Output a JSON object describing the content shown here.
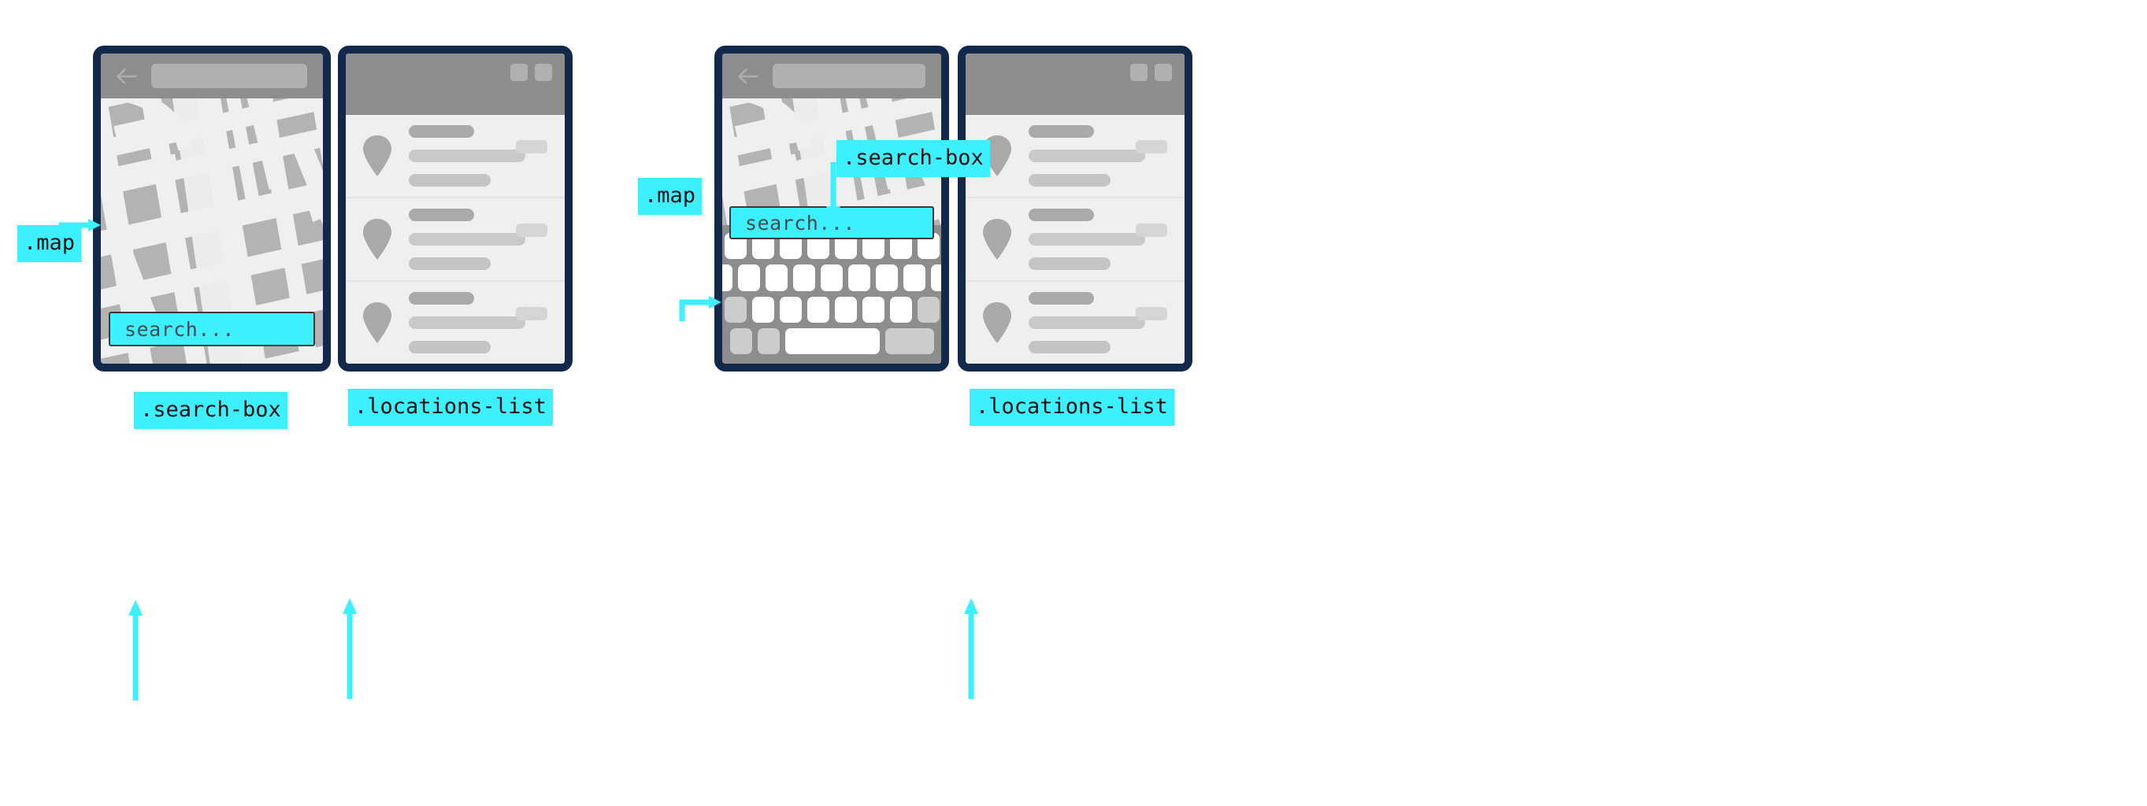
{
  "meta": {
    "accent_color": "#3df0ff",
    "frame_color": "#13294b",
    "map_base_color": "#b3b3b3",
    "road_color": "#efefef",
    "chrome_color": "#8d8d8d"
  },
  "annotations": [
    {
      "id": "map-left",
      "text": ".map"
    },
    {
      "id": "search-box-left",
      "text": ".search-box"
    },
    {
      "id": "locations-list-left",
      "text": ".locations-list"
    },
    {
      "id": "map-right",
      "text": ".map"
    },
    {
      "id": "search-box-right",
      "text": ".search-box"
    },
    {
      "id": "locations-list-right",
      "text": ".locations-list"
    }
  ],
  "screens": {
    "map_a": {
      "name": "map",
      "back_icon": "back-arrow-icon",
      "address_bar_value": "",
      "address_bar_placeholder": "",
      "search_box": {
        "value": "",
        "placeholder": "search..."
      },
      "keyboard_visible": false
    },
    "map_b": {
      "name": "map",
      "back_icon": "back-arrow-icon",
      "address_bar_value": "",
      "address_bar_placeholder": "",
      "search_box": {
        "value": "",
        "placeholder": "search..."
      },
      "keyboard_visible": true,
      "keyboard": {
        "rows": [
          {
            "keys": 10,
            "mods": []
          },
          {
            "keys": 9,
            "mods": []
          },
          {
            "keys": 9,
            "mods": [
              0,
              8
            ]
          },
          {
            "keys": 4,
            "mods": [
              0,
              1,
              3
            ],
            "wide_index": 2
          }
        ]
      }
    },
    "list_a": {
      "name": "locations-list",
      "header_icons": [
        "square-icon",
        "square-icon"
      ],
      "items": [
        {
          "pin": "map-pin-icon",
          "title": "",
          "line1": "",
          "line2": "",
          "badge": ""
        },
        {
          "pin": "map-pin-icon",
          "title": "",
          "line1": "",
          "line2": "",
          "badge": ""
        },
        {
          "pin": "map-pin-icon",
          "title": "",
          "line1": "",
          "line2": "",
          "badge": ""
        }
      ]
    },
    "list_b": {
      "name": "locations-list",
      "header_icons": [
        "square-icon",
        "square-icon"
      ],
      "items": [
        {
          "pin": "map-pin-icon",
          "title": "",
          "line1": "",
          "line2": "",
          "badge": ""
        },
        {
          "pin": "map-pin-icon",
          "title": "",
          "line1": "",
          "line2": "",
          "badge": ""
        },
        {
          "pin": "map-pin-icon",
          "title": "",
          "line1": "",
          "line2": "",
          "badge": ""
        }
      ]
    }
  }
}
